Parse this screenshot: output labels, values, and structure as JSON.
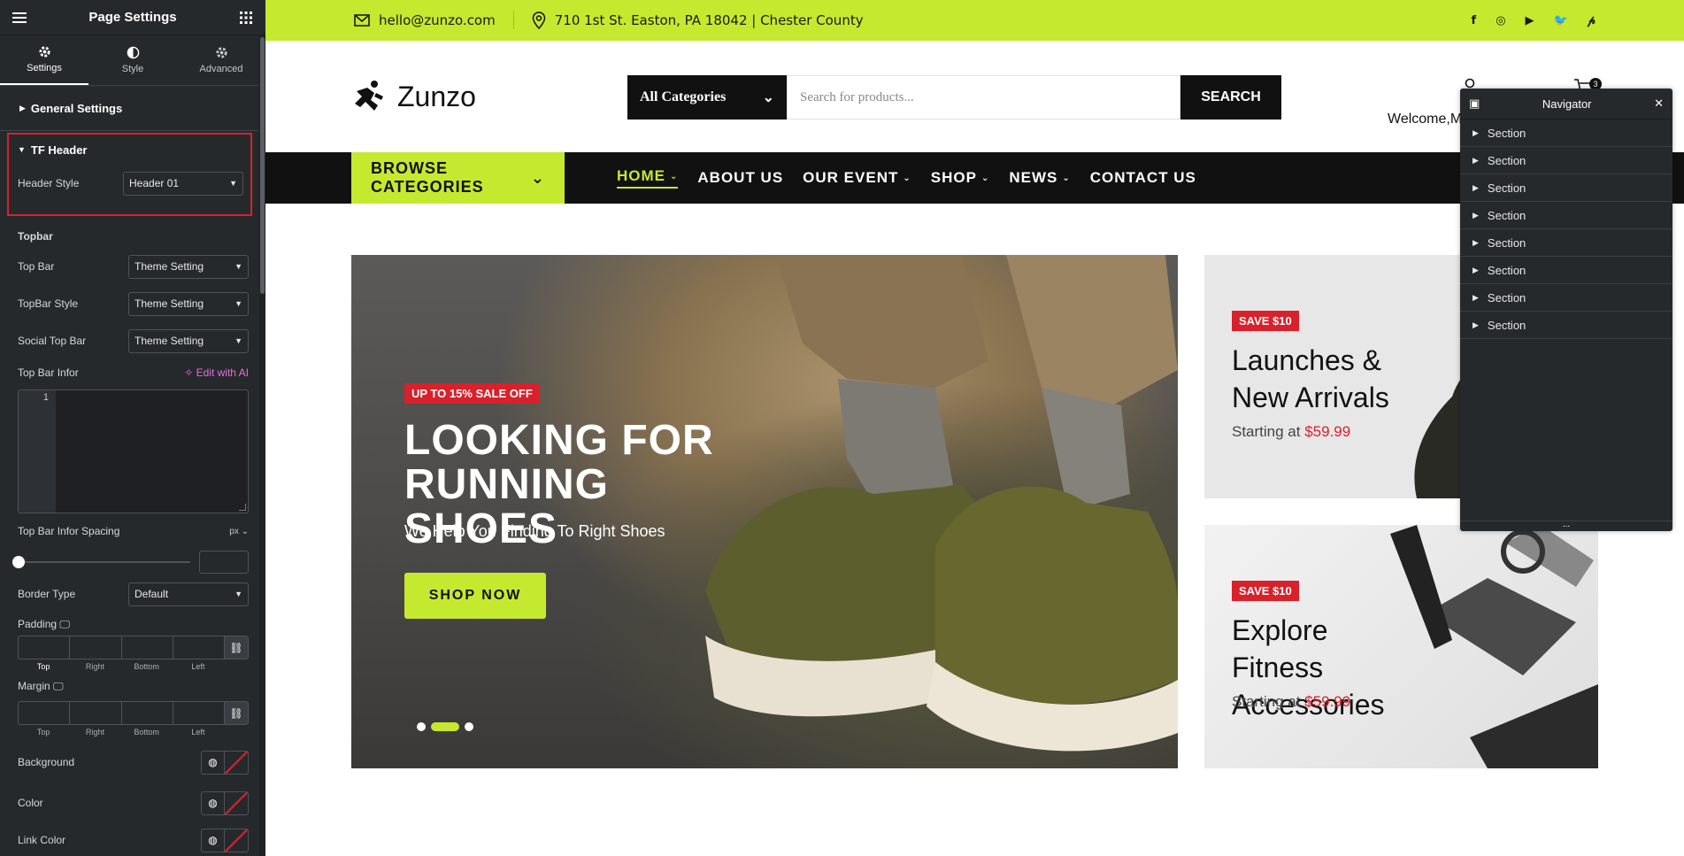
{
  "panel": {
    "title": "Page Settings",
    "tabs": [
      {
        "label": "Settings",
        "icon": "gear-icon",
        "active": true
      },
      {
        "label": "Style",
        "icon": "contrast-icon",
        "active": false
      },
      {
        "label": "Advanced",
        "icon": "gear-icon",
        "active": false
      }
    ],
    "general_settings": "General Settings",
    "tf_header": {
      "title": "TF Header",
      "header_style_label": "Header Style",
      "header_style_value": "Header 01"
    },
    "topbar_title": "Topbar",
    "top_bar": {
      "label": "Top Bar",
      "value": "Theme Setting"
    },
    "topbar_style": {
      "label": "TopBar Style",
      "value": "Theme Setting"
    },
    "social_top_bar": {
      "label": "Social Top Bar",
      "value": "Theme Setting"
    },
    "top_bar_infor": {
      "label": "Top Bar Infor",
      "ai_label": "Edit with AI",
      "line_number": "1"
    },
    "top_bar_infor_spacing": {
      "label": "Top Bar Infor Spacing",
      "unit": "px"
    },
    "border_type": {
      "label": "Border Type",
      "value": "Default"
    },
    "padding": {
      "label": "Padding",
      "sides": [
        "Top",
        "Right",
        "Bottom",
        "Left"
      ]
    },
    "margin": {
      "label": "Margin",
      "sides": [
        "Top",
        "Right",
        "Bottom",
        "Left"
      ]
    },
    "background_label": "Background",
    "color_label": "Color",
    "link_color_label": "Link Color"
  },
  "site": {
    "topbar": {
      "email": "hello@zunzo.com",
      "address": "710 1st St. Easton, PA 18042 | Chester County",
      "social": [
        "f",
        "ig",
        "yt",
        "tw",
        "p"
      ]
    },
    "logo_text": "Zunzo",
    "search": {
      "category": "All Categories",
      "placeholder": "Search for products...",
      "button": "SEARCH"
    },
    "account_text": "Welcome,M",
    "cart_count": "3",
    "browse": "BROWSE CATEGORIES",
    "menu": [
      "HOME",
      "ABOUT US",
      "OUR EVENT",
      "SHOP",
      "NEWS",
      "CONTACT US"
    ],
    "hero": {
      "badge": "UP TO 15% SALE OFF",
      "title_line1": "LOOKING FOR",
      "title_line2": "RUNNING SHOES",
      "subtitle": "We Help You Finding To Right Shoes",
      "button": "SHOP NOW"
    },
    "promo1": {
      "badge": "SAVE $10",
      "title_line1": "Launches &",
      "title_line2": "New Arrivals",
      "price_prefix": "Starting at ",
      "price": "$59.99"
    },
    "promo2": {
      "badge": "SAVE $10",
      "title_line1": "Explore Fitness",
      "title_line2": "Accessories",
      "price_prefix": "Starting at ",
      "price": "$59.99"
    }
  },
  "navigator": {
    "title": "Navigator",
    "sections": [
      "Section",
      "Section",
      "Section",
      "Section",
      "Section",
      "Section",
      "Section",
      "Section"
    ],
    "footer": "..."
  },
  "colors": {
    "accent": "#c5e92f",
    "panel": "#26292c",
    "sale": "#d8212b",
    "ai": "#e36fe0"
  }
}
